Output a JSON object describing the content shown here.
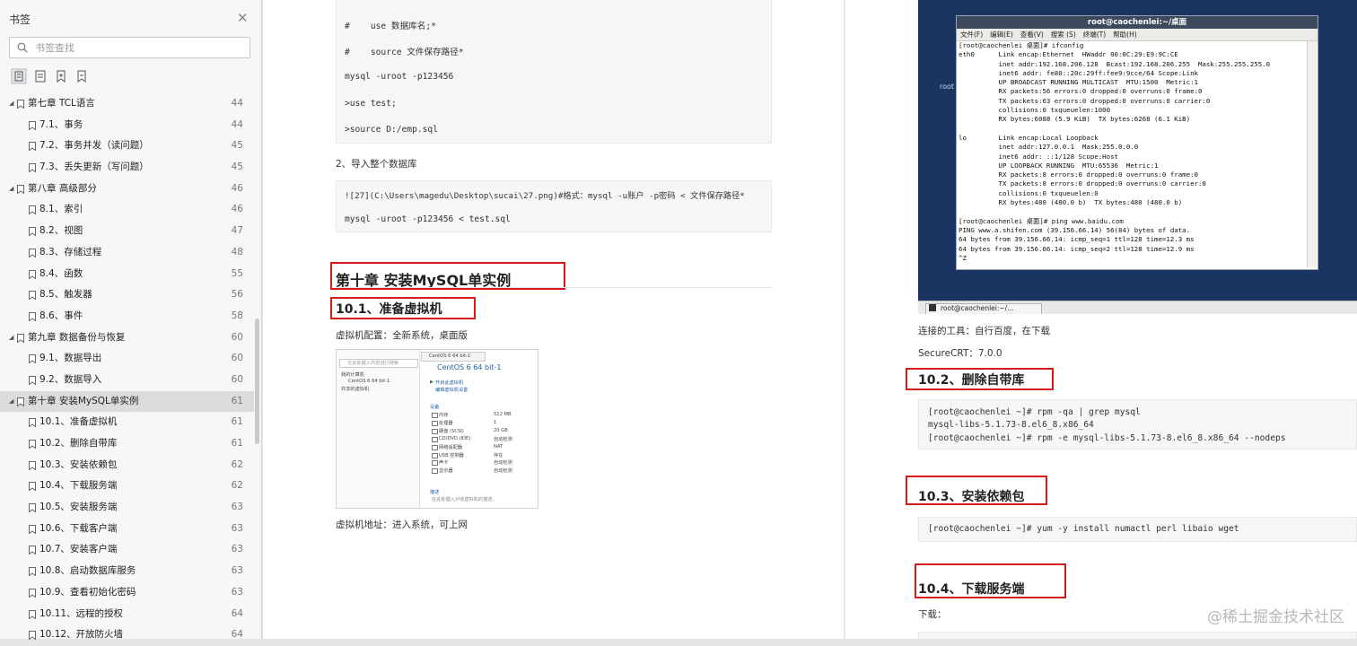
{
  "sidebar": {
    "title": "书签",
    "search_placeholder": "书签查找",
    "items": [
      {
        "label": "第七章 TCL语言",
        "page": "44",
        "level": 0
      },
      {
        "label": "7.1、事务",
        "page": "44",
        "level": 1
      },
      {
        "label": "7.2、事务并发（读问题）",
        "page": "45",
        "level": 1
      },
      {
        "label": "7.3、丢失更新（写问题）",
        "page": "45",
        "level": 1
      },
      {
        "label": "第八章 高级部分",
        "page": "46",
        "level": 0
      },
      {
        "label": "8.1、索引",
        "page": "46",
        "level": 1
      },
      {
        "label": "8.2、视图",
        "page": "47",
        "level": 1
      },
      {
        "label": "8.3、存储过程",
        "page": "48",
        "level": 1
      },
      {
        "label": "8.4、函数",
        "page": "55",
        "level": 1
      },
      {
        "label": "8.5、触发器",
        "page": "56",
        "level": 1
      },
      {
        "label": "8.6、事件",
        "page": "58",
        "level": 1
      },
      {
        "label": "第九章 数据备份与恢复",
        "page": "60",
        "level": 0
      },
      {
        "label": "9.1、数据导出",
        "page": "60",
        "level": 1
      },
      {
        "label": "9.2、数据导入",
        "page": "60",
        "level": 1
      },
      {
        "label": "第十章 安装MySQL单实例",
        "page": "61",
        "level": 0,
        "selected": true
      },
      {
        "label": "10.1、准备虚拟机",
        "page": "61",
        "level": 1
      },
      {
        "label": "10.2、删除自带库",
        "page": "61",
        "level": 1
      },
      {
        "label": "10.3、安装依赖包",
        "page": "62",
        "level": 1
      },
      {
        "label": "10.4、下载服务端",
        "page": "62",
        "level": 1
      },
      {
        "label": "10.5、安装服务端",
        "page": "63",
        "level": 1
      },
      {
        "label": "10.6、下载客户端",
        "page": "63",
        "level": 1
      },
      {
        "label": "10.7、安装客户端",
        "page": "63",
        "level": 1
      },
      {
        "label": "10.8、启动数据库服务",
        "page": "63",
        "level": 1
      },
      {
        "label": "10.9、查看初始化密码",
        "page": "63",
        "level": 1
      },
      {
        "label": "10.11、远程的授权",
        "page": "64",
        "level": 1
      },
      {
        "label": "10.12、开放防火墙",
        "page": "64",
        "level": 1
      }
    ]
  },
  "page1": {
    "code1": [
      "#    use 数据库名;*",
      "#    source 文件保存路径*",
      "mysql -uroot -p123456",
      ">use test;",
      ">source D:/emp.sql"
    ],
    "step2": "2、导入整个数据库",
    "code2": [
      "![27](C:\\Users\\magedu\\Desktop\\sucai\\27.png)#格式：mysql -u账户 -p密码 < 文件保存路径*",
      "mysql -uroot -p123456 < test.sql"
    ],
    "chapter_title": "第十章 安装MySQL单实例",
    "sec_10_1": "10.1、准备虚拟机",
    "vm_config": "虚拟机配置：全新系统，桌面版",
    "vm_address": "虚拟机地址：进入系统，可上网",
    "vm_screenshot": {
      "search": "在此处键入内容进行搜索",
      "tree_root": "我的计算机",
      "tree_vm": "CentOS 6 64 bit-1",
      "tree_shared": "共享的虚拟机",
      "tab": "CentOS 6 64 bit-1",
      "heading": "CentOS 6 64 bit-1",
      "action1": "开启此虚拟机",
      "action2": "编辑虚拟机设置",
      "devices_title": "设备",
      "devices": [
        {
          "name": "内存",
          "value": "512 MB"
        },
        {
          "name": "处理器",
          "value": "1"
        },
        {
          "name": "硬盘 (SCSI)",
          "value": "20 GB"
        },
        {
          "name": "CD/DVD (IDE)",
          "value": "自动检测"
        },
        {
          "name": "网络适配器",
          "value": "NAT"
        },
        {
          "name": "USB 控制器",
          "value": "存在"
        },
        {
          "name": "声卡",
          "value": "自动检测"
        },
        {
          "name": "显示器",
          "value": "自动检测"
        }
      ],
      "desc_title": "描述",
      "desc_text": "在此处键入对该虚拟机的描述。"
    }
  },
  "page2": {
    "terminal": {
      "title": "root@caochenlei:~/桌面",
      "menu": [
        "文件(F)",
        "编辑(E)",
        "查看(V)",
        "搜索 (S)",
        "终端(T)",
        "帮助(H)"
      ],
      "desktop_label": "root",
      "taskbar_item": "root@caochenlei:~/...",
      "lines": [
        "[root@caochenlei 桌面]# ifconfig",
        "eth0      Link encap:Ethernet  HWaddr 00:0C:29:E9:9C:CE",
        "          inet addr:192.168.206.128  Bcast:192.168.206.255  Mask:255.255.255.0",
        "          inet6 addr: fe80::20c:29ff:fee9:9cce/64 Scope:Link",
        "          UP BROADCAST RUNNING MULTICAST  MTU:1500  Metric:1",
        "          RX packets:56 errors:0 dropped:0 overruns:0 frame:0",
        "          TX packets:63 errors:0 dropped:0 overruns:0 carrier:0",
        "          collisions:0 txqueuelen:1000",
        "          RX bytes:6088 (5.9 KiB)  TX bytes:6268 (6.1 KiB)",
        "",
        "lo        Link encap:Local Loopback",
        "          inet addr:127.0.0.1  Mask:255.0.0.0",
        "          inet6 addr: ::1/128 Scope:Host",
        "          UP LOOPBACK RUNNING  MTU:65536  Metric:1",
        "          RX packets:8 errors:0 dropped:0 overruns:0 frame:0",
        "          TX packets:8 errors:0 dropped:0 overruns:0 carrier:0",
        "          collisions:0 txqueuelen:0",
        "          RX bytes:480 (480.0 b)  TX bytes:480 (480.0 b)",
        "",
        "[root@caochenlei 桌面]# ping www.baidu.com",
        "PING www.a.shifen.com (39.156.66.14) 56(84) bytes of data.",
        "64 bytes from 39.156.66.14: icmp_seq=1 ttl=128 time=12.3 ms",
        "64 bytes from 39.156.66.14: icmp_seq=2 ttl=128 time=12.9 ms",
        "^Z"
      ]
    },
    "tool_line": "连接的工具：自行百度，在下载",
    "securecrt": "SecureCRT：7.0.0",
    "sec_10_2": "10.2、删除自带库",
    "code_10_2": [
      "[root@caochenlei ~]# rpm -qa | grep mysql",
      "mysql-libs-5.1.73-8.el6_8.x86_64",
      "[root@caochenlei ~]# rpm -e mysql-libs-5.1.73-8.el6_8.x86_64 --nodeps"
    ],
    "sec_10_3": "10.3、安装依赖包",
    "code_10_3": [
      "[root@caochenlei ~]# yum -y install numactl perl libaio wget"
    ],
    "sec_10_4": "10.4、下载服务端",
    "download_label": "下载："
  },
  "watermark": "@稀土掘金技术社区"
}
